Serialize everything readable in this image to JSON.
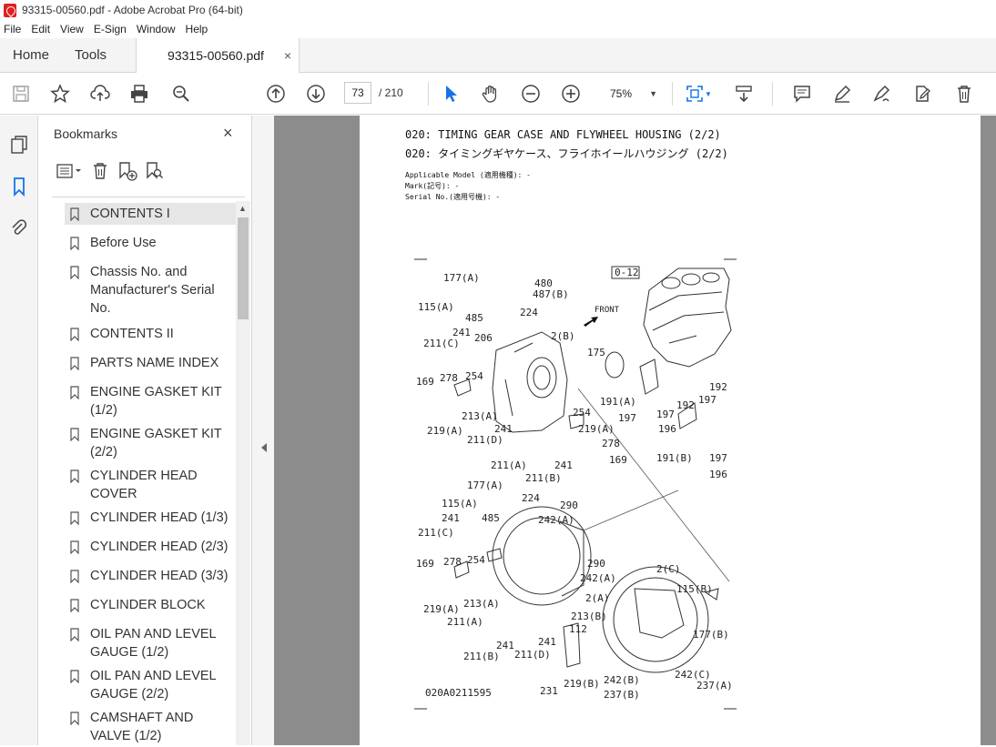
{
  "window": {
    "title": "93315-00560.pdf - Adobe Acrobat Pro (64-bit)"
  },
  "menu": [
    "File",
    "Edit",
    "View",
    "E-Sign",
    "Window",
    "Help"
  ],
  "tabs": {
    "home": "Home",
    "tools": "Tools",
    "document": "93315-00560.pdf",
    "close": "×"
  },
  "toolbar": {
    "current_page": "73",
    "total_pages": "/ 210",
    "zoom": "75%"
  },
  "bookmarks": {
    "title": "Bookmarks",
    "close": "×",
    "items": [
      "CONTENTS  I",
      "Before Use",
      "Chassis No. and Manufacturer's Serial No.",
      "CONTENTS II",
      "PARTS NAME INDEX",
      "ENGINE GASKET KIT (1/2)",
      "ENGINE GASKET KIT (2/2)",
      "CYLINDER HEAD COVER",
      "CYLINDER HEAD (1/3)",
      "CYLINDER HEAD (2/3)",
      "CYLINDER HEAD (3/3)",
      "CYLINDER BLOCK",
      "OIL PAN AND LEVEL GAUGE (1/2)",
      "OIL PAN AND LEVEL GAUGE (2/2)",
      "CAMSHAFT AND VALVE (1/2)"
    ]
  },
  "page": {
    "title_en": "020: TIMING GEAR CASE AND FLYWHEEL HOUSING (2/2)",
    "title_jp": "020: タイミングギヤケース、フライホイールハウジング (2/2)",
    "applicable_model": "Applicable Model (適用機種): -",
    "mark": "Mark(記号): -",
    "serial": "Serial No.(適用号機): -",
    "figure_code": "020A0211595",
    "ref_box": "0-12",
    "front": "FRONT",
    "callouts": {
      "c177a_top": "177(A)",
      "c480": "480",
      "c487b": "487(B)",
      "c115a_top": "115(A)",
      "c485_top": "485",
      "c224_top": "224",
      "c2b": "2(B)",
      "c241_top": "241",
      "c206": "206",
      "c211c_top": "211(C)",
      "c175": "175",
      "c278_top": "278",
      "c254_top": "254",
      "c169_top": "169",
      "c213a_top": "213(A)",
      "c191a": "191(A)",
      "c197_a": "197",
      "c197_b": "197",
      "c192_a": "192",
      "c192_b": "192",
      "c197_c": "197",
      "c196_a": "196",
      "c219a_top": "219(A)",
      "c241_mid": "241",
      "c211d_top": "211(D)",
      "c254_mid": "254",
      "c219a_mid": "219(A)",
      "c278_mid": "278",
      "c169_mid": "169",
      "c191b": "191(B)",
      "c197_d": "197",
      "c196_b": "196",
      "c211a_top": "211(A)",
      "c241_mid2": "241",
      "c211b_top": "211(B)",
      "c177a_low": "177(A)",
      "c224_low": "224",
      "c115a_low": "115(A)",
      "c290_a": "290",
      "c241_low": "241",
      "c485_low": "485",
      "c242a_a": "242(A)",
      "c211c_low": "211(C)",
      "c290_b": "290",
      "c169_low": "169",
      "c278_low": "278",
      "c254_low": "254",
      "c242a_b": "242(A)",
      "c2c": "2(C)",
      "c115b": "115(B)",
      "c2a": "2(A)",
      "c219a_low": "219(A)",
      "c213a_low": "213(A)",
      "c213b": "213(B)",
      "c177b": "177(B)",
      "c211a_low": "211(A)",
      "c112": "112",
      "c241_low2": "241",
      "c241_low3": "241",
      "c211b_low": "211(B)",
      "c211d_low": "211(D)",
      "c242c": "242(C)",
      "c242b": "242(B)",
      "c237a": "237(A)",
      "c231": "231",
      "c219b": "219(B)",
      "c237b": "237(B)"
    }
  }
}
